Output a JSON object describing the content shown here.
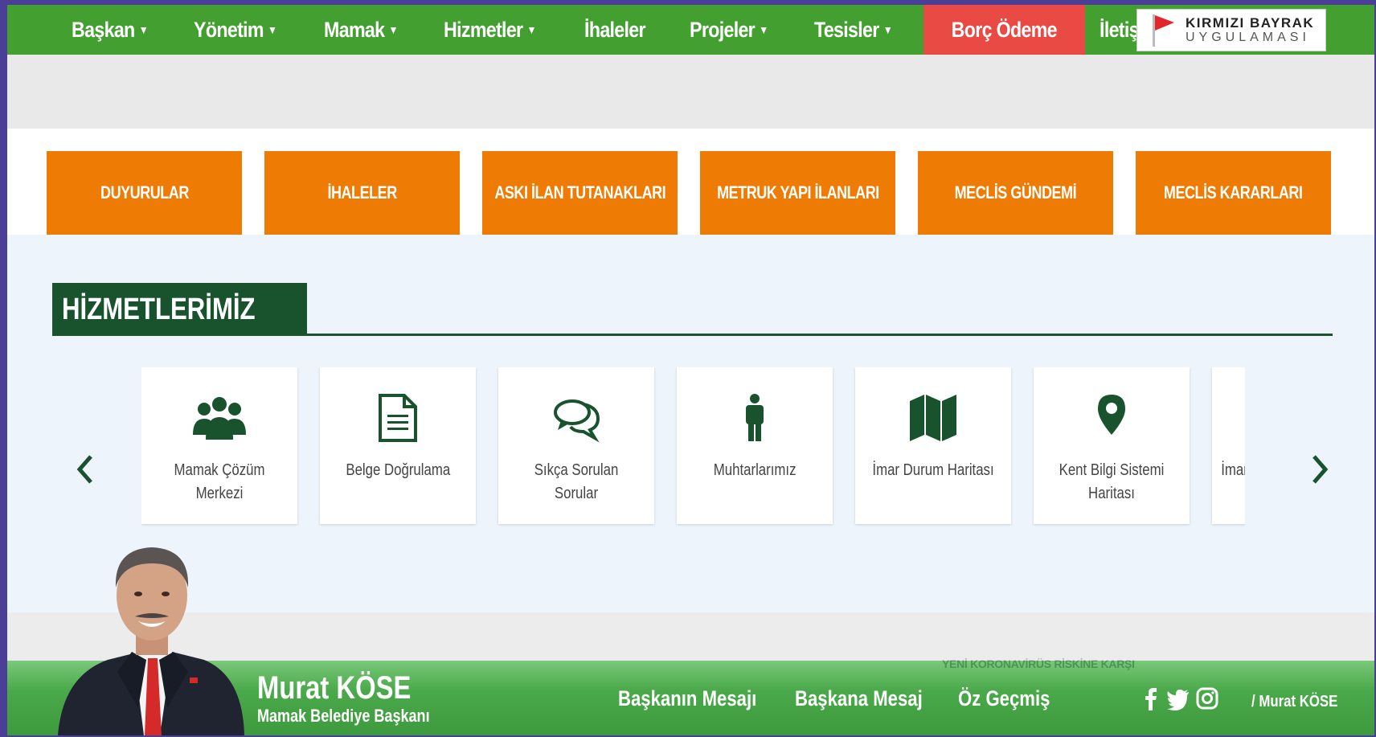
{
  "nav": {
    "items": [
      {
        "label": "Başkan",
        "caret": true
      },
      {
        "label": "Yönetim",
        "caret": true
      },
      {
        "label": "Mamak",
        "caret": true
      },
      {
        "label": "Hizmetler",
        "caret": true
      },
      {
        "label": "İhaleler",
        "caret": false
      },
      {
        "label": "Projeler",
        "caret": true
      },
      {
        "label": "Tesisler",
        "caret": true
      },
      {
        "label": "Borç Ödeme",
        "caret": false
      },
      {
        "label": "İletişim",
        "caret": true
      }
    ],
    "flag": {
      "line1": "KIRMIZI BAYRAK",
      "line2": "UYGULAMASI"
    }
  },
  "quick_links": [
    "DUYURULAR",
    "İHALELER",
    "ASKI İLAN TUTANAKLARI",
    "METRUK YAPI İLANLARI",
    "MECLİS GÜNDEMİ",
    "MECLİS KARARLARI"
  ],
  "services": {
    "title": "HİZMETLERİMİZ",
    "cards": [
      {
        "label": "Mamak Çözüm Merkezi",
        "icon": "users-icon"
      },
      {
        "label": "Belge Doğrulama",
        "icon": "document-icon"
      },
      {
        "label": "Sıkça Sorulan Sorular",
        "icon": "chat-icon"
      },
      {
        "label": "Muhtarlarımız",
        "icon": "person-icon"
      },
      {
        "label": "İmar Durum Haritası",
        "icon": "map-icon"
      },
      {
        "label": "Kent Bilgi Sistemi Haritası",
        "icon": "map-marker-icon"
      },
      {
        "label": "İmar",
        "icon": ""
      }
    ]
  },
  "footer": {
    "mayor_name": "Murat KÖSE",
    "mayor_title": "Mamak Belediye Başkanı",
    "links": [
      "Başkanın Mesajı",
      "Başkana Mesaj",
      "Öz Geçmiş"
    ],
    "social_handle": "/ Murat KÖSE",
    "ghost_text": "YENİ KORONAVİRÜS RİSKİNE KARŞI"
  },
  "colors": {
    "nav": "#43a030",
    "highlight": "#e94a43",
    "orange": "#ee7b03",
    "dark_green": "#18532e"
  }
}
